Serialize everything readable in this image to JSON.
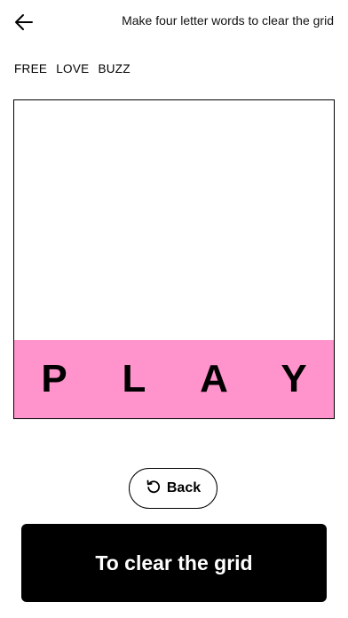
{
  "header": {
    "back_icon": "arrow-left-icon",
    "instruction": "Make four letter words to clear the grid"
  },
  "found_words": [
    "FREE",
    "LOVE",
    "BUZZ"
  ],
  "board": {
    "tile_color": "#FF93CC",
    "tiles": [
      "P",
      "L",
      "A",
      "Y"
    ]
  },
  "back_button": {
    "label": "Back",
    "icon": "undo-icon"
  },
  "main_button": {
    "label": "To clear the grid",
    "color": "#000000"
  }
}
